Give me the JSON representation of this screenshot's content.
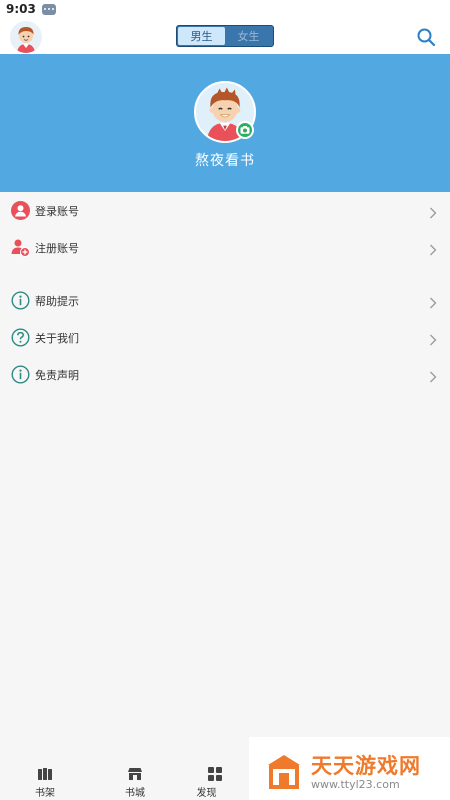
{
  "status_bar": {
    "time": "9:03"
  },
  "header": {
    "gender_tabs": [
      {
        "label": "男生",
        "active": true
      },
      {
        "label": "女生",
        "active": false
      }
    ],
    "search_icon": "search-icon"
  },
  "profile": {
    "name": "熬夜看书"
  },
  "menu": {
    "items": [
      {
        "label": "登录账号",
        "icon": "user-icon"
      },
      {
        "label": "注册账号",
        "icon": "add-user-icon"
      },
      {
        "label": "帮助提示",
        "icon": "info-icon"
      },
      {
        "label": "关于我们",
        "icon": "question-icon"
      },
      {
        "label": "免责声明",
        "icon": "info-icon"
      }
    ]
  },
  "tabs": [
    {
      "label": "书架",
      "icon": "bookshelf-icon"
    },
    {
      "label": "书城",
      "icon": "store-icon"
    },
    {
      "label": "发现",
      "icon": "discover-icon"
    }
  ],
  "watermark": {
    "title": "天天游戏网",
    "url": "www.ttyl23.com"
  },
  "colors": {
    "primary": "#52a9e2",
    "watermark": "#f07a2c",
    "red_icon": "#e9505a",
    "teal_icon": "#2e8b83"
  }
}
